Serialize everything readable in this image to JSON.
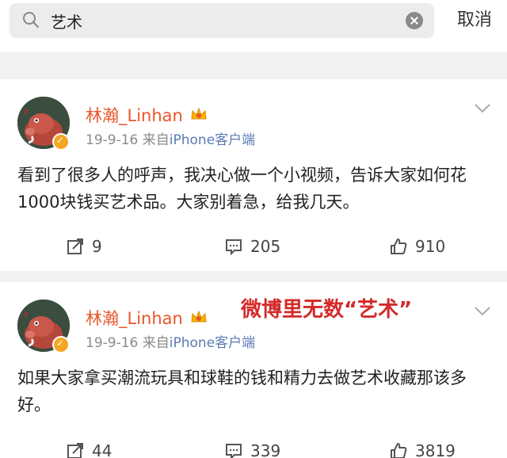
{
  "search": {
    "query": "艺术",
    "cancel_label": "取消"
  },
  "posts": [
    {
      "username": "林瀚_Linhan",
      "date": "19-9-16",
      "source_prefix": "来自",
      "source": "iPhone客户端",
      "text": "看到了很多人的呼声，我决心做一个小视频，告诉大家如何花1000块钱买艺术品。大家别着急，给我几天。",
      "reposts": "9",
      "comments": "205",
      "likes": "910"
    },
    {
      "username": "林瀚_Linhan",
      "date": "19-9-16",
      "source_prefix": "来自",
      "source": "iPhone客户端",
      "text": "如果大家拿买潮流玩具和球鞋的钱和精力去做艺术收藏那该多好。",
      "reposts": "44",
      "comments": "339",
      "likes": "3819",
      "overlay_caption": "微博里无数“艺术”"
    }
  ],
  "colors": {
    "username": "#e8562a",
    "source_link": "#5b7ab3",
    "caption": "#d42a2a"
  }
}
